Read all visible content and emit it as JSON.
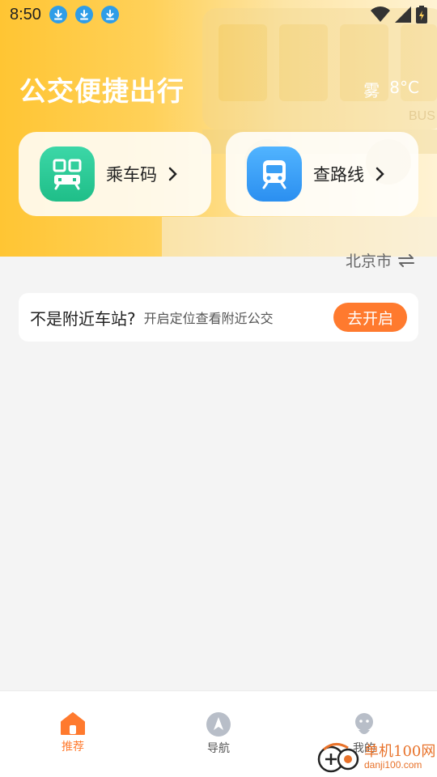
{
  "status_bar": {
    "time": "8:50",
    "download_icons": [
      "download-icon",
      "download-icon",
      "download-icon"
    ],
    "right_icons": [
      "wifi-icon",
      "signal-icon",
      "battery-icon"
    ]
  },
  "hero": {
    "title": "公交便捷出行",
    "weather": {
      "condition": "雾",
      "temperature": "8°C"
    },
    "cards": [
      {
        "label": "乘车码",
        "icon": "qr-code-icon",
        "color": "#2cc895"
      },
      {
        "label": "查路线",
        "icon": "train-icon",
        "color": "#3a9ff5"
      }
    ]
  },
  "city": {
    "name": "北京市",
    "icon": "switch-icon"
  },
  "location_prompt": {
    "title": "不是附近车站?",
    "subtitle": "开启定位查看附近公交",
    "button": "去开启",
    "button_color": "#ff7a2e"
  },
  "tab_bar": {
    "items": [
      {
        "label": "推荐",
        "icon": "home-icon",
        "active": true
      },
      {
        "label": "导航",
        "icon": "navigation-icon",
        "active": false
      },
      {
        "label": "我的",
        "icon": "profile-icon",
        "active": false
      }
    ],
    "active_color": "#ff7a2e"
  },
  "watermark": {
    "name": "单机100网",
    "url": "danji100.com"
  }
}
